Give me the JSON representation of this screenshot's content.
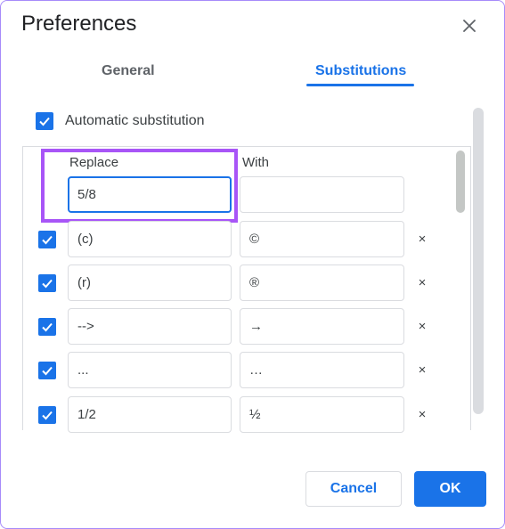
{
  "dialog": {
    "title": "Preferences",
    "close_icon": "close-icon",
    "accent_color": "#1a73e8",
    "highlight_color": "#a855f7"
  },
  "tabs": [
    {
      "label": "General",
      "active": false
    },
    {
      "label": "Substitutions",
      "active": true
    }
  ],
  "auto_substitution": {
    "label": "Automatic substitution",
    "checked": true
  },
  "table": {
    "headers": {
      "replace": "Replace",
      "with": "With"
    },
    "new_entry": {
      "replace": "5/8",
      "with": ""
    },
    "rows": [
      {
        "checked": true,
        "replace": "(c)",
        "with": "©",
        "delete_icon": "×"
      },
      {
        "checked": true,
        "replace": "(r)",
        "with": "®",
        "delete_icon": "×"
      },
      {
        "checked": true,
        "replace": "-->",
        "with": "→",
        "delete_icon": "×"
      },
      {
        "checked": true,
        "replace": "...",
        "with": "…",
        "delete_icon": "×"
      },
      {
        "checked": true,
        "replace": "1/2",
        "with": "½",
        "delete_icon": "×"
      }
    ]
  },
  "footer": {
    "cancel_label": "Cancel",
    "ok_label": "OK"
  }
}
